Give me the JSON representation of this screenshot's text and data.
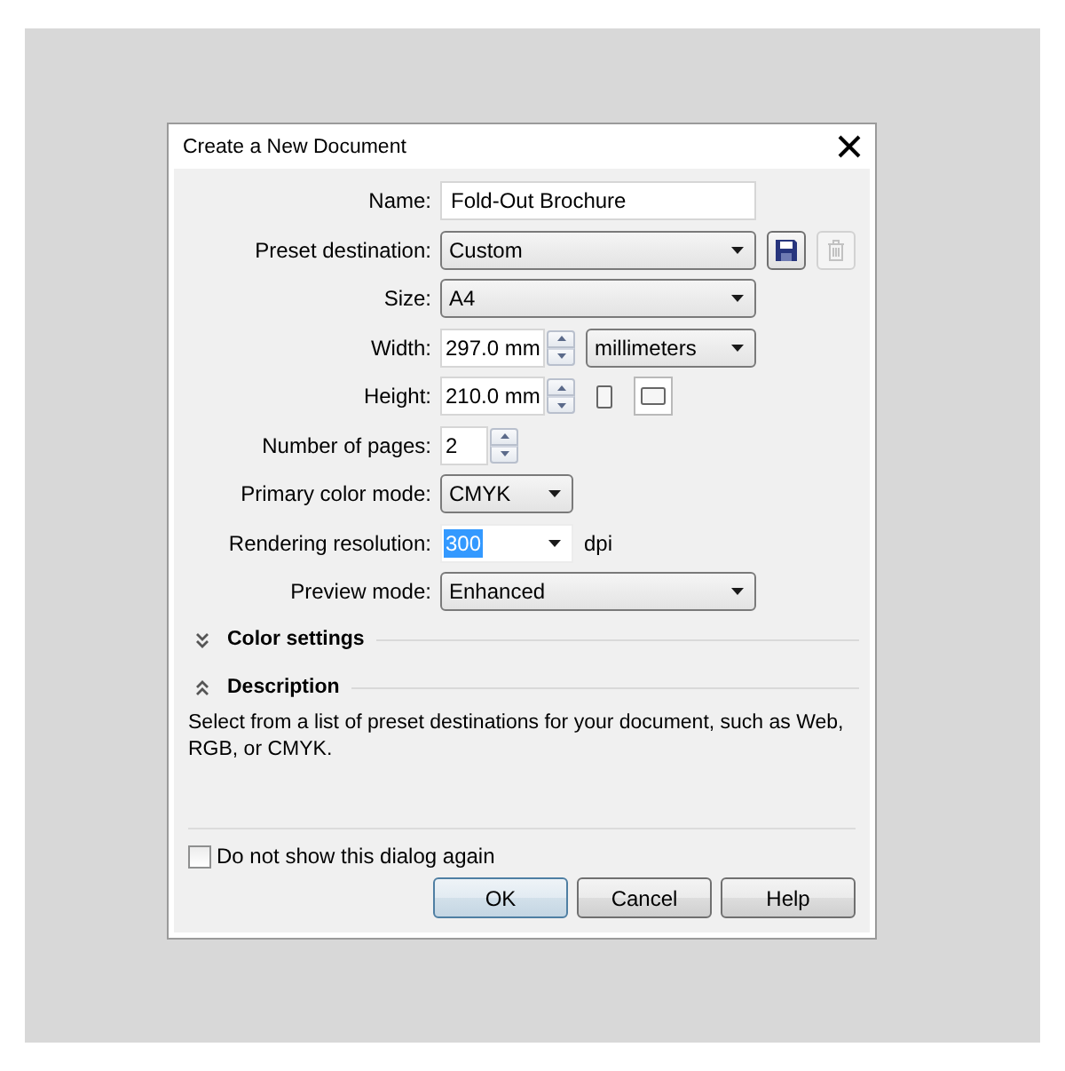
{
  "window": {
    "title": "Create a New Document"
  },
  "fields": [
    {
      "kind": "text",
      "label": "Name:",
      "value": "Fold-Out Brochure",
      "compact": false
    },
    {
      "kind": "dropdown",
      "label": "Preset destination:",
      "value": "Custom",
      "compact": false,
      "actions": [
        {
          "kind": "save",
          "disabled": false
        },
        {
          "kind": "delete",
          "disabled": true
        }
      ]
    },
    {
      "kind": "dropdown",
      "label": "Size:",
      "value": "A4",
      "compact": false
    },
    {
      "kind": "spin",
      "label": "Width:",
      "value": "297.0 mm",
      "compact": false,
      "unit": "millimeters"
    },
    {
      "kind": "spin",
      "label": "Height:",
      "value": "210.0 mm",
      "compact": false,
      "orientation": [
        {
          "kind": "portrait",
          "selected": false
        },
        {
          "kind": "landscape",
          "selected": true
        }
      ]
    },
    {
      "kind": "spin",
      "label": "Number of pages:",
      "value": "2",
      "compact": true
    },
    {
      "kind": "dropdown",
      "label": "Primary color mode:",
      "value": "CMYK",
      "compact": true
    },
    {
      "kind": "combo",
      "label": "Rendering resolution:",
      "value": "300",
      "value_selected": true,
      "suffix": "dpi",
      "compact": true
    },
    {
      "kind": "dropdown",
      "label": "Preview mode:",
      "value": "Enhanced",
      "compact": false
    }
  ],
  "sections": [
    {
      "title": "Color settings",
      "expanded": false
    },
    {
      "title": "Description",
      "expanded": true,
      "body": "Select from a list of preset destinations for your document, such as Web, RGB, or CMYK."
    }
  ],
  "dont_show_again": {
    "label": "Do not show this dialog again",
    "checked": false
  },
  "buttons": [
    {
      "label": "OK",
      "default": true
    },
    {
      "label": "Cancel",
      "default": false
    },
    {
      "label": "Help",
      "default": false
    }
  ]
}
